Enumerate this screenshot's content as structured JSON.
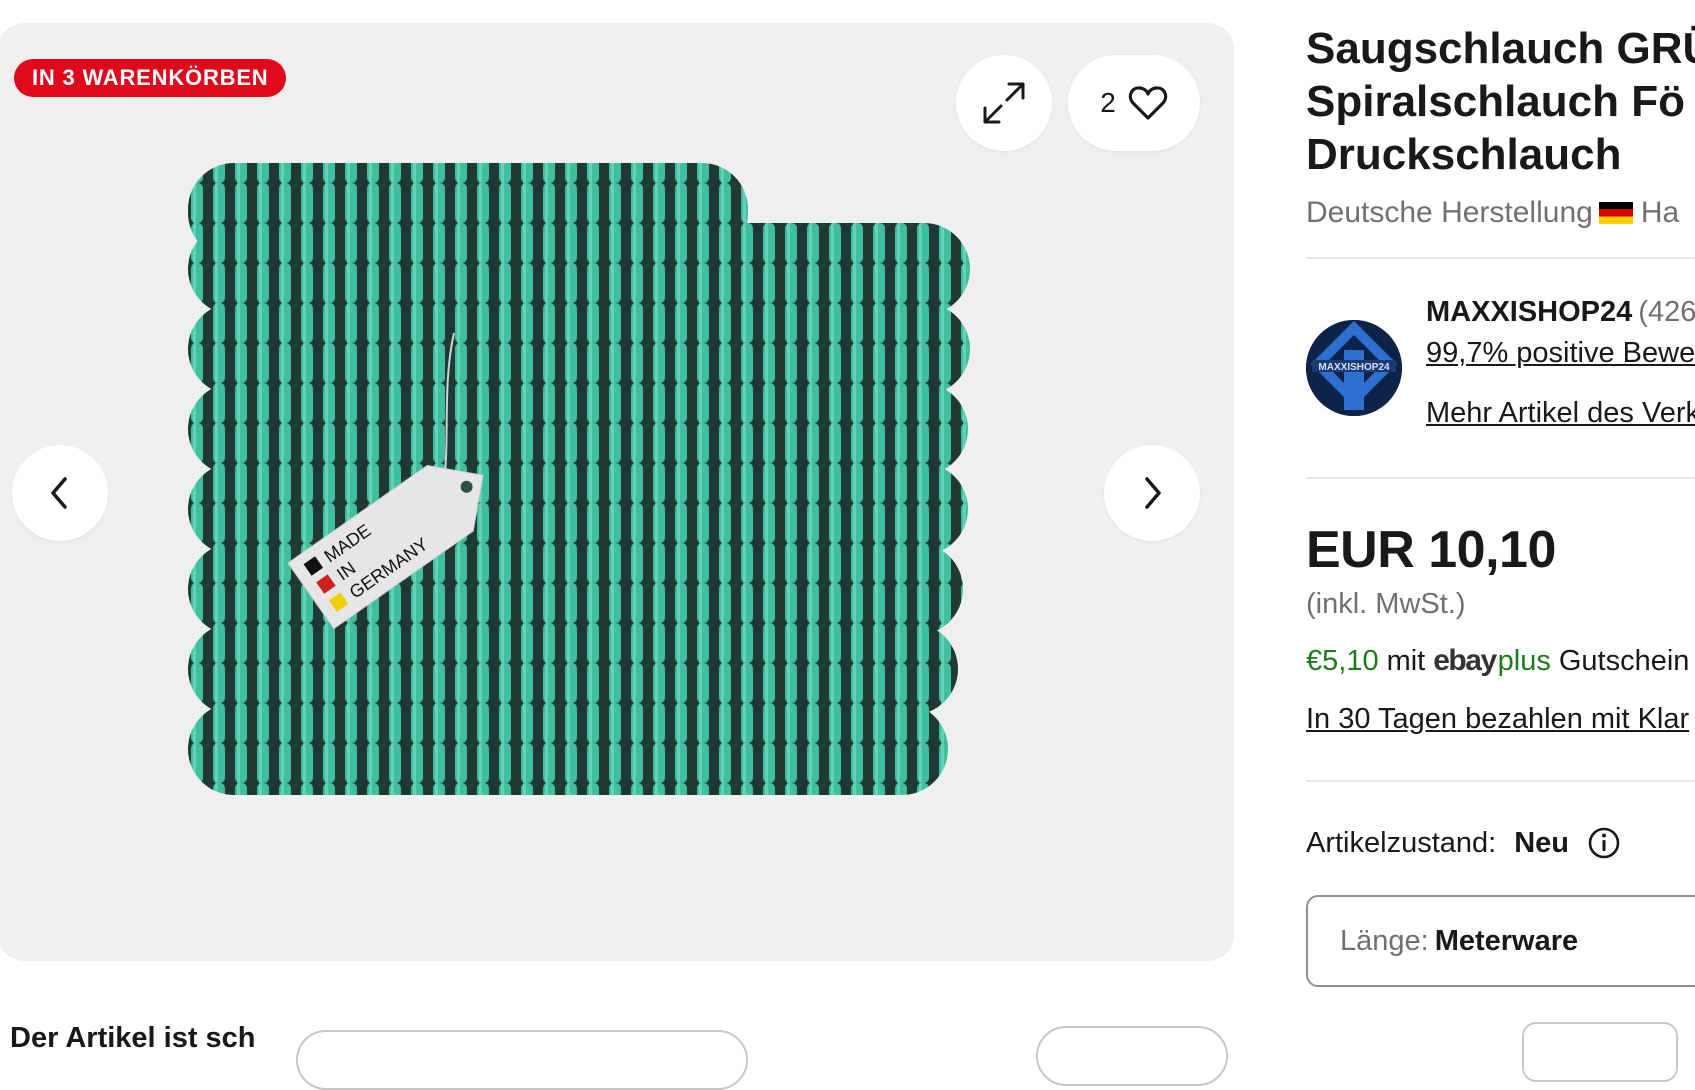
{
  "gallery": {
    "badge": "IN 3 WARENKÖRBEN",
    "watch_count": "2",
    "image_label": {
      "line1": "MADE",
      "line2": "IN",
      "line3": "GERMANY"
    }
  },
  "product": {
    "title_line1": "Saugschlauch GRÜ",
    "title_line2": "Spiralschlauch Fö",
    "title_line3": "Druckschlauch",
    "subtitle_left": "Deutsche Herstellung",
    "subtitle_right": "Ha"
  },
  "seller": {
    "name": "MAXXISHOP24",
    "count": "(426",
    "feedback_link": "99,7% positive Bewe",
    "more_items_link": "Mehr Artikel des Verk",
    "avatar_text": "MAXXISHOP24"
  },
  "pricing": {
    "price": "EUR 10,10",
    "vat_note": "(inkl. MwSt.)",
    "plus_amount": "€5,10",
    "plus_mit": "mit",
    "plus_ebay": "ebay",
    "plus_word": "plus",
    "plus_suffix": "Gutschein",
    "klarna_link": "In 30 Tagen bezahlen mit Klar"
  },
  "condition": {
    "label": "Artikelzustand:",
    "value": "Neu"
  },
  "variant": {
    "label": "Länge:",
    "value": "Meterware"
  },
  "bottom": {
    "text": "Der Artikel ist sch"
  },
  "colors": {
    "badge_red": "#e0081b",
    "hose_teal": "#3fbf9f",
    "hose_dark": "#1e3a33",
    "ebay_plus_green": "#1f7a1f"
  },
  "icons": {
    "expand": "expand-arrows-icon",
    "favorite": "heart-outline-icon",
    "prev": "chevron-left-icon",
    "next": "chevron-right-icon",
    "info": "info-circle-icon",
    "flag": "germany-flag-icon"
  }
}
